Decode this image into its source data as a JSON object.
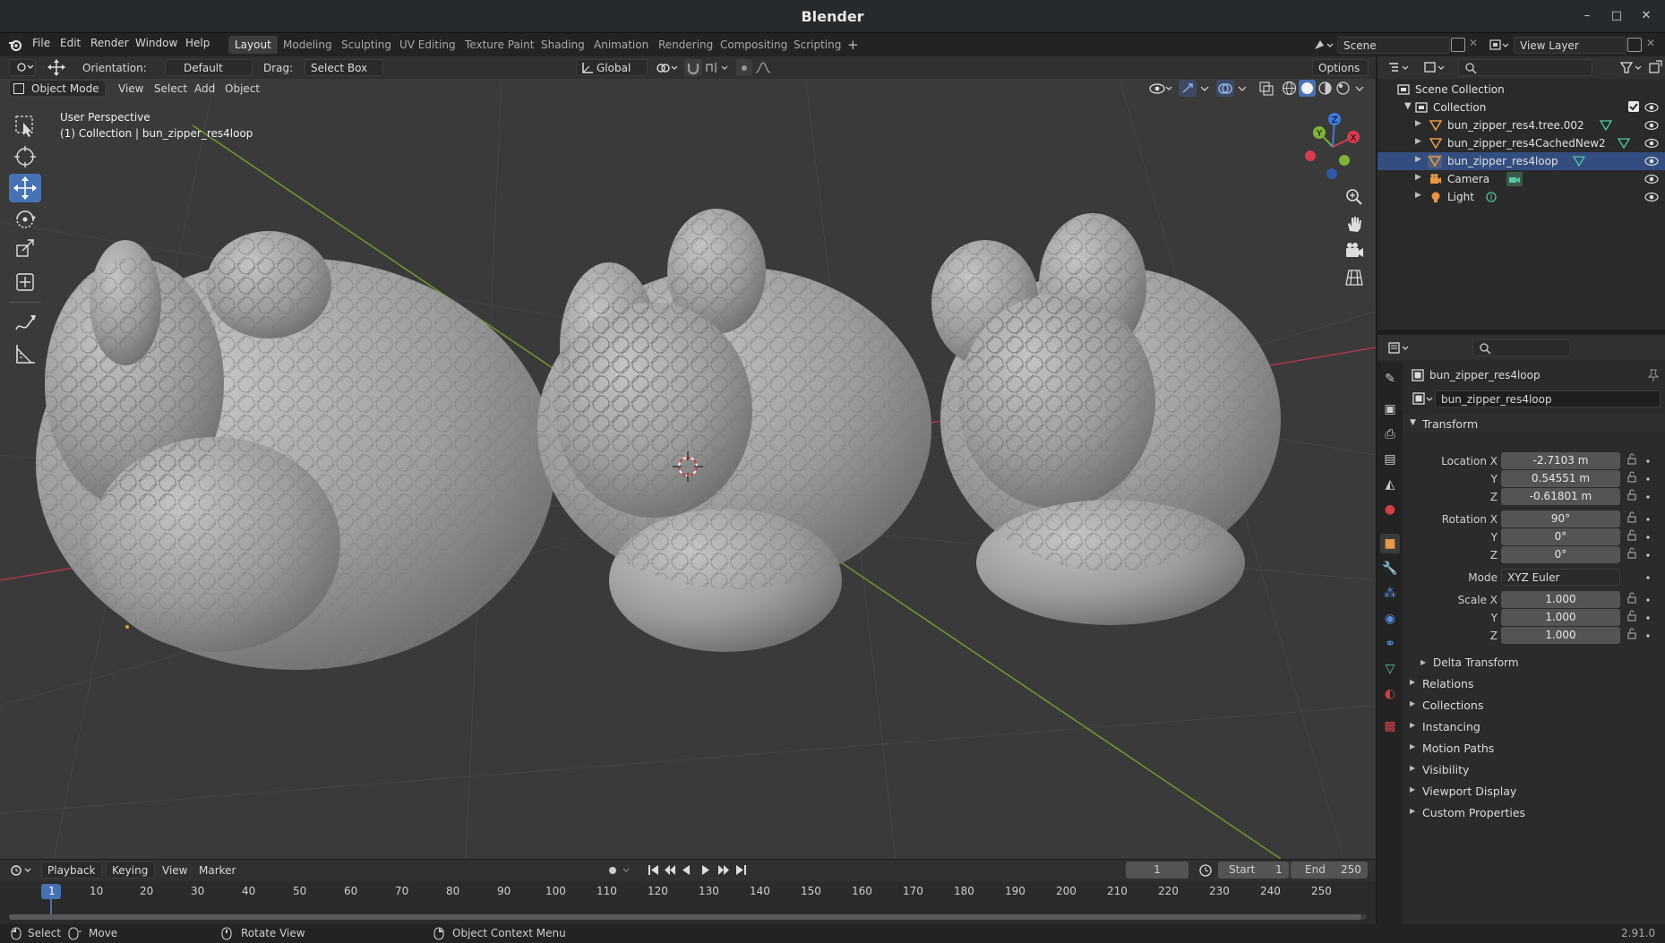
{
  "window": {
    "title": "Blender"
  },
  "menu": [
    "File",
    "Edit",
    "Render",
    "Window",
    "Help"
  ],
  "workspaces": [
    "Layout",
    "Modeling",
    "Sculpting",
    "UV Editing",
    "Texture Paint",
    "Shading",
    "Animation",
    "Rendering",
    "Compositing",
    "Scripting"
  ],
  "active_workspace": "Layout",
  "scene": {
    "name": "Scene"
  },
  "view_layer": {
    "name": "View Layer"
  },
  "toolbar": {
    "orientation_label": "Orientation:",
    "orientation_value": "Default",
    "drag_label": "Drag:",
    "drag_value": "Select Box",
    "transform_orientation": "Global",
    "options_label": "Options"
  },
  "viewport_header": {
    "mode": "Object Mode",
    "menus": [
      "View",
      "Select",
      "Add",
      "Object"
    ]
  },
  "viewport": {
    "perspective": "User Perspective",
    "collection_info": "(1) Collection | bun_zipper_res4loop",
    "gizmo_axes": {
      "x": "X",
      "y": "Y",
      "z": "Z"
    }
  },
  "outliner": {
    "root": "Scene Collection",
    "collection": "Collection",
    "items": [
      {
        "name": "bun_zipper_res4.tree.002",
        "selected": false
      },
      {
        "name": "bun_zipper_res4CachedNew2",
        "selected": false
      },
      {
        "name": "bun_zipper_res4loop",
        "selected": true
      },
      {
        "name": "Camera",
        "selected": false
      },
      {
        "name": "Light",
        "selected": false
      }
    ]
  },
  "properties": {
    "object_name": "bun_zipper_res4loop",
    "object_field": "bun_zipper_res4loop",
    "transform": {
      "title": "Transform",
      "location_label": "Location X",
      "location": [
        "-2.7103 m",
        "0.54551 m",
        "-0.61801 m"
      ],
      "rotation_label": "Rotation X",
      "rotation": [
        "90°",
        "0°",
        "0°"
      ],
      "mode_label": "Mode",
      "mode_value": "XYZ Euler",
      "scale_label": "Scale X",
      "scale": [
        "1.000",
        "1.000",
        "1.000"
      ],
      "axis_y": "Y",
      "axis_z": "Z",
      "delta": "Delta Transform"
    },
    "panels": [
      "Relations",
      "Collections",
      "Instancing",
      "Motion Paths",
      "Visibility",
      "Viewport Display",
      "Custom Properties"
    ]
  },
  "timeline": {
    "menus": [
      "Playback",
      "Keying",
      "View",
      "Marker"
    ],
    "current_frame": "1",
    "start_label": "Start",
    "start": "1",
    "end_label": "End",
    "end": "250",
    "ticks": [
      "1",
      "10",
      "20",
      "30",
      "40",
      "50",
      "60",
      "70",
      "80",
      "90",
      "100",
      "110",
      "120",
      "130",
      "140",
      "150",
      "160",
      "170",
      "180",
      "190",
      "200",
      "210",
      "220",
      "230",
      "240",
      "250"
    ]
  },
  "statusbar": {
    "select": "Select",
    "move": "Move",
    "rotate": "Rotate View",
    "context": "Object Context Menu",
    "version": "2.91.0"
  },
  "colors": {
    "accent": "#4772b3",
    "selected_row": "#334d80",
    "x_axis": "#d83a50",
    "y_axis": "#7fb33a",
    "z_axis": "#3d7ae0",
    "mesh": "#9a9a9a"
  }
}
